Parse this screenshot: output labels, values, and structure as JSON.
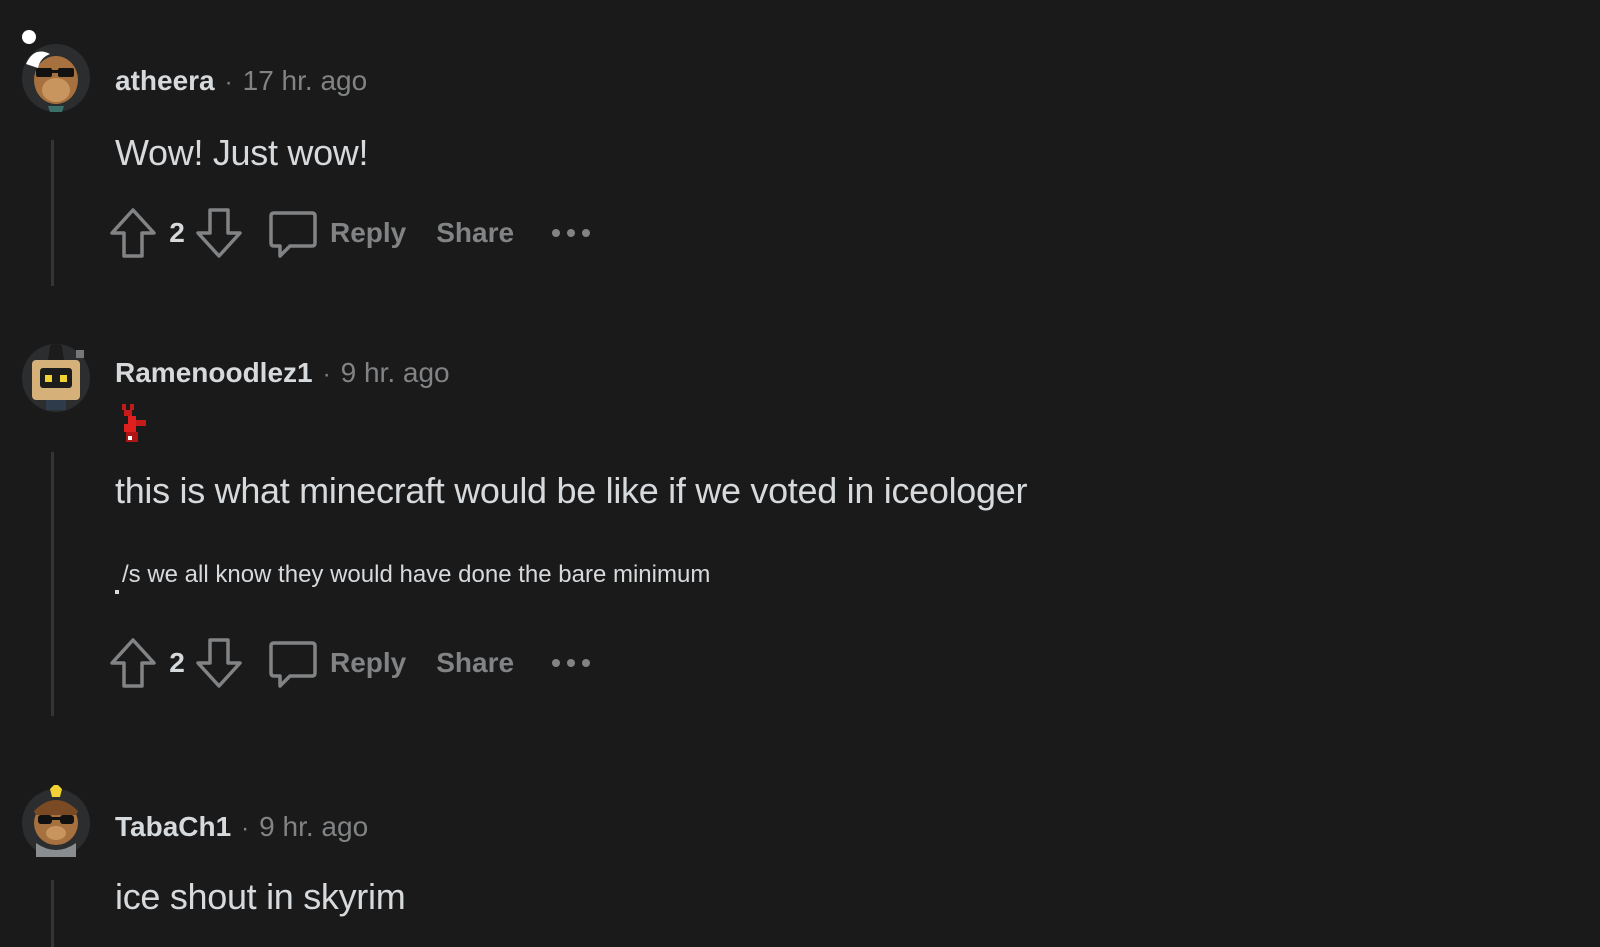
{
  "comments": [
    {
      "username": "atheera",
      "time": "17 hr. ago",
      "body": "Wow! Just wow!",
      "score": "2",
      "reply_label": "Reply",
      "share_label": "Share"
    },
    {
      "username": "Ramenoodlez1",
      "time": "9 hr. ago",
      "body": "this is what minecraft would be like if we voted in iceologer",
      "small": "/s we all know they would have done the bare minimum",
      "score": "2",
      "reply_label": "Reply",
      "share_label": "Share"
    },
    {
      "username": "TabaCh1",
      "time": "9 hr. ago",
      "body": "ice shout in skyrim"
    }
  ],
  "separator": "·",
  "colors": {
    "background": "#1a1a1b",
    "text": "#d7dadc",
    "muted": "#818384",
    "thread_line": "#343536"
  },
  "icons": [
    "upvote-icon",
    "downvote-icon",
    "comment-icon",
    "more-icon"
  ]
}
